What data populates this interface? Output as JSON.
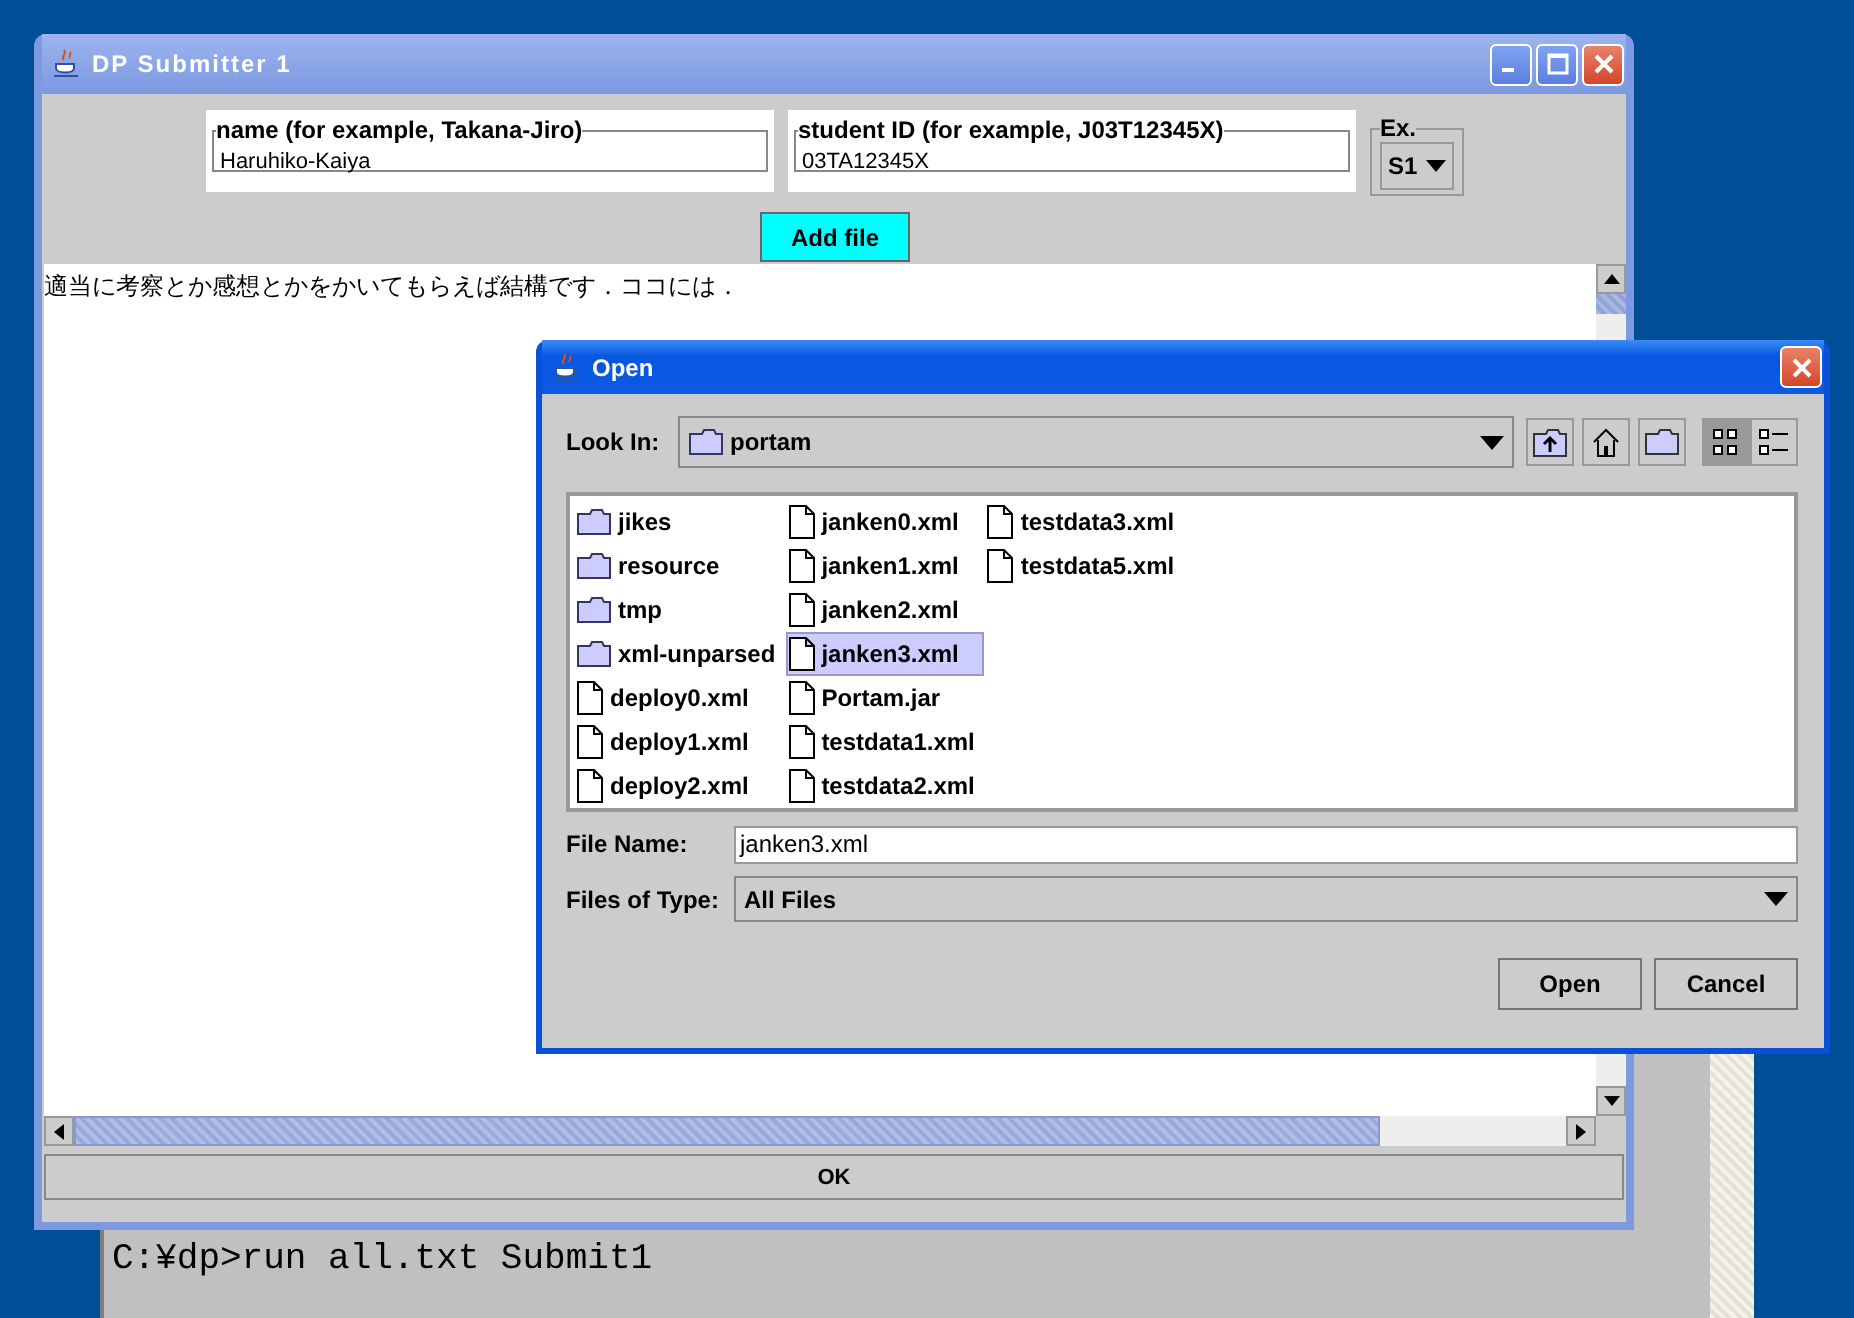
{
  "console": {
    "command": "C:¥dp>run all.txt Submit1"
  },
  "main_window": {
    "title": "DP Submitter 1",
    "name_field": {
      "label": "name (for example, Takana-Jiro)",
      "value": "Haruhiko-Kaiya"
    },
    "id_field": {
      "label": "student ID (for example, J03T12345X)",
      "value": "03TA12345X"
    },
    "exercise": {
      "label": "Ex.",
      "value": "S1"
    },
    "add_file_button": "Add file",
    "comment_text": "適当に考察とか感想とかをかいてもらえば結構です．ココには．",
    "ok_button": "OK"
  },
  "open_dialog": {
    "title": "Open",
    "look_in": {
      "label": "Look In:",
      "value": "portam"
    },
    "view_buttons": [
      {
        "kind": "list",
        "selected": true
      },
      {
        "kind": "details",
        "selected": false
      }
    ],
    "files": [
      {
        "name": "jikes",
        "kind": "folder",
        "selected": false
      },
      {
        "name": "resource",
        "kind": "folder",
        "selected": false
      },
      {
        "name": "tmp",
        "kind": "folder",
        "selected": false
      },
      {
        "name": "xml-unparsed",
        "kind": "folder",
        "selected": false
      },
      {
        "name": "deploy0.xml",
        "kind": "file",
        "selected": false
      },
      {
        "name": "deploy1.xml",
        "kind": "file",
        "selected": false
      },
      {
        "name": "deploy2.xml",
        "kind": "file",
        "selected": false
      },
      {
        "name": "janken0.xml",
        "kind": "file",
        "selected": false
      },
      {
        "name": "janken1.xml",
        "kind": "file",
        "selected": false
      },
      {
        "name": "janken2.xml",
        "kind": "file",
        "selected": false
      },
      {
        "name": "janken3.xml",
        "kind": "file",
        "selected": true
      },
      {
        "name": "Portam.jar",
        "kind": "file",
        "selected": false
      },
      {
        "name": "testdata1.xml",
        "kind": "file",
        "selected": false
      },
      {
        "name": "testdata2.xml",
        "kind": "file",
        "selected": false
      },
      {
        "name": "testdata3.xml",
        "kind": "file",
        "selected": false
      },
      {
        "name": "testdata5.xml",
        "kind": "file",
        "selected": false
      }
    ],
    "file_name": {
      "label": "File Name:",
      "value": "janken3.xml"
    },
    "files_of_type": {
      "label": "Files of Type:",
      "value": "All Files"
    },
    "buttons": [
      "Open",
      "Cancel"
    ]
  }
}
